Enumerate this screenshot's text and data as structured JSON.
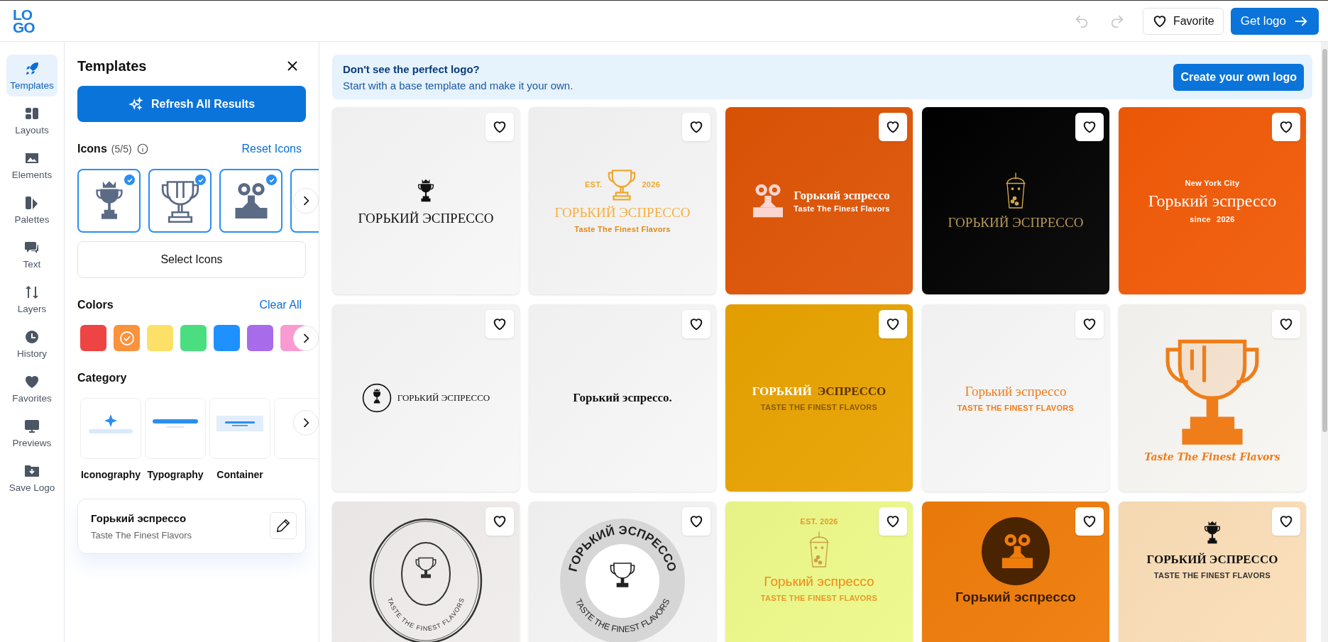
{
  "header": {
    "logo": [
      "LO",
      "GO"
    ],
    "undo": {
      "disabled": true
    },
    "redo": {
      "disabled": true
    },
    "favorite_button": "Favorite",
    "get_logo_button": "Get logo"
  },
  "rail": [
    {
      "label": "Templates",
      "selected": true
    },
    {
      "label": "Layouts",
      "selected": false
    },
    {
      "label": "Elements",
      "selected": false
    },
    {
      "label": "Palettes",
      "selected": false
    },
    {
      "label": "Text",
      "selected": false
    },
    {
      "label": "Layers",
      "selected": false
    },
    {
      "label": "History",
      "selected": false
    },
    {
      "label": "Favorites",
      "selected": false
    },
    {
      "label": "Previews",
      "selected": false
    },
    {
      "label": "Save Logo",
      "selected": false
    }
  ],
  "panel": {
    "title": "Templates",
    "refresh_button": "Refresh All Results",
    "icons": {
      "title": "Icons",
      "count": "(5/5)",
      "reset": "Reset Icons",
      "select_button": "Select Icons",
      "items": [
        {
          "kind": "crowned-trophy",
          "selected": true
        },
        {
          "kind": "cup-trophy",
          "selected": true
        },
        {
          "kind": "stamp",
          "selected": true
        },
        {
          "kind": "hidden",
          "selected": true
        }
      ]
    },
    "colors": {
      "title": "Colors",
      "clear": "Clear All",
      "swatches": [
        {
          "color": "#ef4444",
          "selected": false
        },
        {
          "color": "#fb923c",
          "selected": true
        },
        {
          "color": "#fde068",
          "selected": false
        },
        {
          "color": "#4ade80",
          "selected": false
        },
        {
          "color": "#1e90ff",
          "selected": false
        },
        {
          "color": "#a86bea",
          "selected": false
        },
        {
          "color": "#f99bd0",
          "selected": false
        }
      ]
    },
    "category": {
      "title": "Category",
      "items": [
        {
          "label": "Iconography",
          "kind": "iconography"
        },
        {
          "label": "Typography",
          "kind": "typography"
        },
        {
          "label": "Container",
          "kind": "container"
        },
        {
          "kind": "hidden"
        }
      ]
    },
    "text_card": {
      "name": "Горький эспрессо",
      "tagline": "Taste The Finest Flavors"
    }
  },
  "banner": {
    "title": "Don't see the perfect logo?",
    "subtitle": "Start with a base template and make it your own.",
    "button": "Create your own logo"
  },
  "cards": [
    {
      "color": "#f7f7f7",
      "favorited": false,
      "rows": [
        [
          {
            "kind": "trophy",
            "color": "#111111"
          }
        ],
        [
          {
            "kind": "serif",
            "text": "ГОРЬКИЙ ЭСПРЕССО",
            "color": "#111111"
          }
        ]
      ]
    },
    {
      "color": "#f5f5f5",
      "favorited": false,
      "rows": [
        [
          {
            "kind": "tiny",
            "text": "EST.",
            "color": "#f0a830"
          },
          {
            "kind": "cup",
            "color": "#f0a830"
          },
          {
            "kind": "tiny",
            "text": "2026",
            "color": "#f0a830"
          }
        ],
        [
          {
            "kind": "serif",
            "text": "ГОРЬКИЙ ЭСПРЕССО",
            "color": "#f5b042"
          }
        ],
        [
          {
            "kind": "tiny",
            "text": "Taste The Finest Flavors",
            "color": "#e08a1a"
          }
        ]
      ]
    },
    {
      "color": "#de5405",
      "favorited": false,
      "rows": [
        [
          {
            "kind": "stamp",
            "color": "#fbd5cf"
          },
          {
            "kind": "stack",
            "items": [
              {
                "kind": "serif-bold",
                "text": "Горький эспрессо",
                "color": "#ffffff"
              },
              {
                "kind": "tiny",
                "text": "Taste The Finest Flavors",
                "color": "#ffffff"
              }
            ]
          }
        ]
      ]
    },
    {
      "color": "#000000",
      "favorited": false,
      "rows": [
        [
          {
            "kind": "drink",
            "color": "#d4a94c"
          }
        ],
        [
          {
            "kind": "serif",
            "text": "ГОРЬКИЙ ЭСПРЕССО",
            "color": "#b8985a"
          }
        ]
      ]
    },
    {
      "color": "#f25a07",
      "favorited": false,
      "rows": [
        [
          {
            "kind": "tiny",
            "text": "New York City",
            "color": "#ffffff"
          }
        ],
        [
          {
            "kind": "serif-large",
            "text": "Горький эспрессо",
            "color": "#ffffff"
          }
        ],
        [
          {
            "kind": "tiny",
            "text": "since",
            "color": "#ffffff"
          },
          {
            "kind": "tiny",
            "text": "2026",
            "color": "#ffffff"
          }
        ]
      ]
    },
    {
      "color": "#f7f7f7",
      "favorited": false,
      "rows": [
        [
          {
            "kind": "circle-trophy",
            "color": "#111111"
          },
          {
            "kind": "serif-small",
            "text": "ГОРЬКИЙ ЭСПРЕССО",
            "color": "#111111"
          }
        ]
      ]
    },
    {
      "color": "#f7f7f7",
      "favorited": false,
      "rows": [
        [
          {
            "kind": "serif-bold",
            "text": "Горький эспрессо.",
            "color": "#111111"
          }
        ]
      ]
    },
    {
      "color": "#e9a300",
      "favorited": false,
      "rows": [
        [
          {
            "kind": "serif-bold",
            "text": "ГОРЬКИЙ",
            "color": "#ffffff"
          },
          {
            "kind": "serif-bold",
            "text": "ЭСПРЕССО",
            "color": "#5b3300"
          }
        ],
        [
          {
            "kind": "tiny",
            "text": "TASTE THE FINEST FLAVORS",
            "color": "#8a5a00"
          }
        ]
      ]
    },
    {
      "color": "#f8f8f8",
      "favorited": false,
      "rows": [
        [
          {
            "kind": "serif",
            "text": "Горький эспрессо",
            "color": "#ef7d1a"
          }
        ],
        [
          {
            "kind": "tiny",
            "text": "TASTE THE FINEST FLAVORS",
            "color": "#ef7d1a"
          }
        ]
      ]
    },
    {
      "color": "#f8f6f2",
      "favorited": false,
      "rows": [
        [
          {
            "kind": "big-cup",
            "color": "#ef7d1a"
          }
        ],
        [
          {
            "kind": "script",
            "text": "Taste The Finest Flavors",
            "color": "#ef7d1a"
          }
        ]
      ]
    },
    {
      "color": "#f1eded",
      "favorited": false,
      "rows": [
        [
          {
            "kind": "oval",
            "color": "#333333",
            "arc": "TASTE THE FINEST FLAVORS"
          }
        ]
      ]
    },
    {
      "color": "#f5f5f5",
      "favorited": false,
      "rows": [
        [
          {
            "kind": "ring",
            "color": "#222222",
            "arc_top": "ГОРЬКИЙ ЭСПРЕССО",
            "arc": "TASTE THE FINEST FLAVORS"
          }
        ]
      ]
    },
    {
      "color": "#eefa8a",
      "favorited": false,
      "rows": [
        [
          {
            "kind": "tiny",
            "text": "EST. 2026",
            "color": "#e59a2a"
          }
        ],
        [
          {
            "kind": "drink",
            "color": "#c9a040"
          }
        ],
        [
          {
            "kind": "sans",
            "text": "Горький эспрессо",
            "color": "#ef8a1a"
          }
        ],
        [
          {
            "kind": "tiny",
            "text": "TASTE THE FINEST FLAVORS",
            "color": "#e59a2a"
          }
        ]
      ]
    },
    {
      "color": "#f07c0a",
      "favorited": false,
      "rows": [
        [
          {
            "kind": "stamp-circle",
            "color": "#4a2400"
          }
        ],
        [
          {
            "kind": "sans-bold",
            "text": "Горький эспрессо",
            "color": "#3a1d00"
          }
        ]
      ]
    },
    {
      "color": "#fbdfb8",
      "favorited": false,
      "rows": [
        [
          {
            "kind": "trophy",
            "color": "#111111"
          }
        ],
        [
          {
            "kind": "serif-bold",
            "text": "ГОРЬКИЙ ЭСПРЕССО",
            "color": "#111111"
          }
        ],
        [
          {
            "kind": "tiny",
            "text": "TASTE THE FINEST FLAVORS",
            "color": "#333333"
          }
        ]
      ]
    }
  ]
}
